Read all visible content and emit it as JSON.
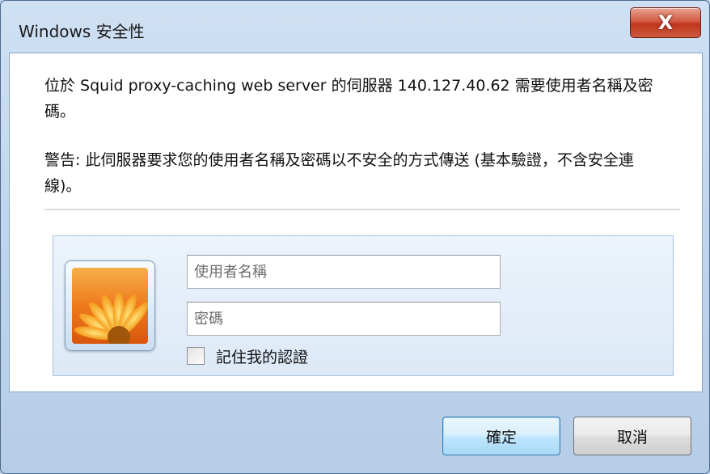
{
  "window": {
    "title": "Windows 安全性",
    "close_label": "X"
  },
  "message": {
    "line1": "位於 Squid proxy-caching web server 的伺服器 140.127.40.62 需要使用者名稱及密碼。",
    "warning": "警告: 此伺服器要求您的使用者名稱及密碼以不安全的方式傳送 (基本驗證，不含安全連線)。"
  },
  "credentials": {
    "avatar_icon": "flower-avatar-icon",
    "username_placeholder": "使用者名稱",
    "password_placeholder": "密碼",
    "remember_label": "記住我的認證",
    "remember_checked": false
  },
  "buttons": {
    "ok_label": "確定",
    "cancel_label": "取消"
  },
  "colors": {
    "ok_border": "#3c7fb1",
    "close_red": "#c1361d",
    "panel_border": "#a7c2df"
  }
}
